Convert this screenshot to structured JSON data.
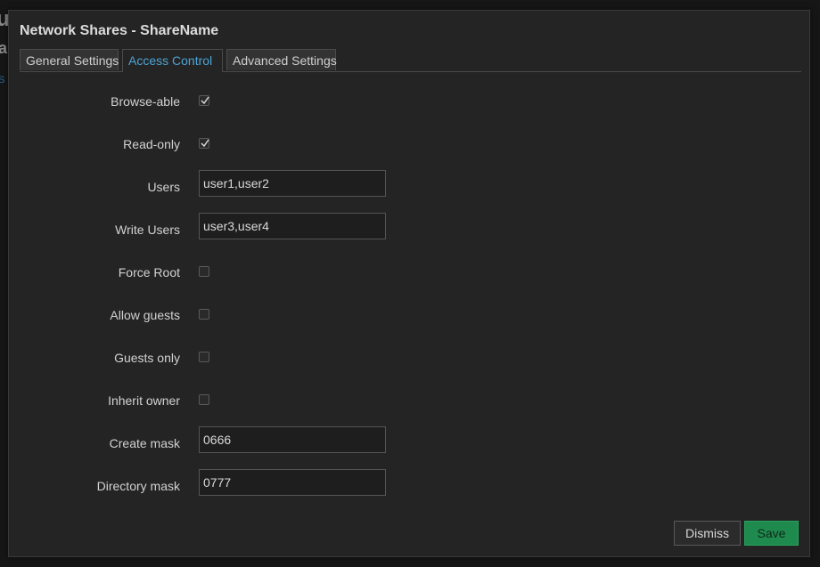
{
  "background": {
    "frag_a": "u",
    "frag_b": "a",
    "frag_c": "S"
  },
  "modal": {
    "title": "Network Shares - ShareName",
    "tabs": [
      {
        "label": "General Settings",
        "active": false
      },
      {
        "label": "Access Control",
        "active": true
      },
      {
        "label": "Advanced Settings",
        "active": false
      }
    ]
  },
  "form": {
    "browseable": {
      "label": "Browse-able",
      "checked": true
    },
    "readonly": {
      "label": "Read-only",
      "checked": true
    },
    "users": {
      "label": "Users",
      "value": "user1,user2"
    },
    "write_users": {
      "label": "Write Users",
      "value": "user3,user4"
    },
    "force_root": {
      "label": "Force Root",
      "checked": false
    },
    "allow_guests": {
      "label": "Allow guests",
      "checked": false
    },
    "guests_only": {
      "label": "Guests only",
      "checked": false
    },
    "inherit_owner": {
      "label": "Inherit owner",
      "checked": false
    },
    "create_mask": {
      "label": "Create mask",
      "value": "0666"
    },
    "directory_mask": {
      "label": "Directory mask",
      "value": "0777"
    }
  },
  "buttons": {
    "dismiss": "Dismiss",
    "save": "Save"
  },
  "colors": {
    "accent": "#4da3d4",
    "save": "#1f8a4e",
    "background": "#242424"
  }
}
